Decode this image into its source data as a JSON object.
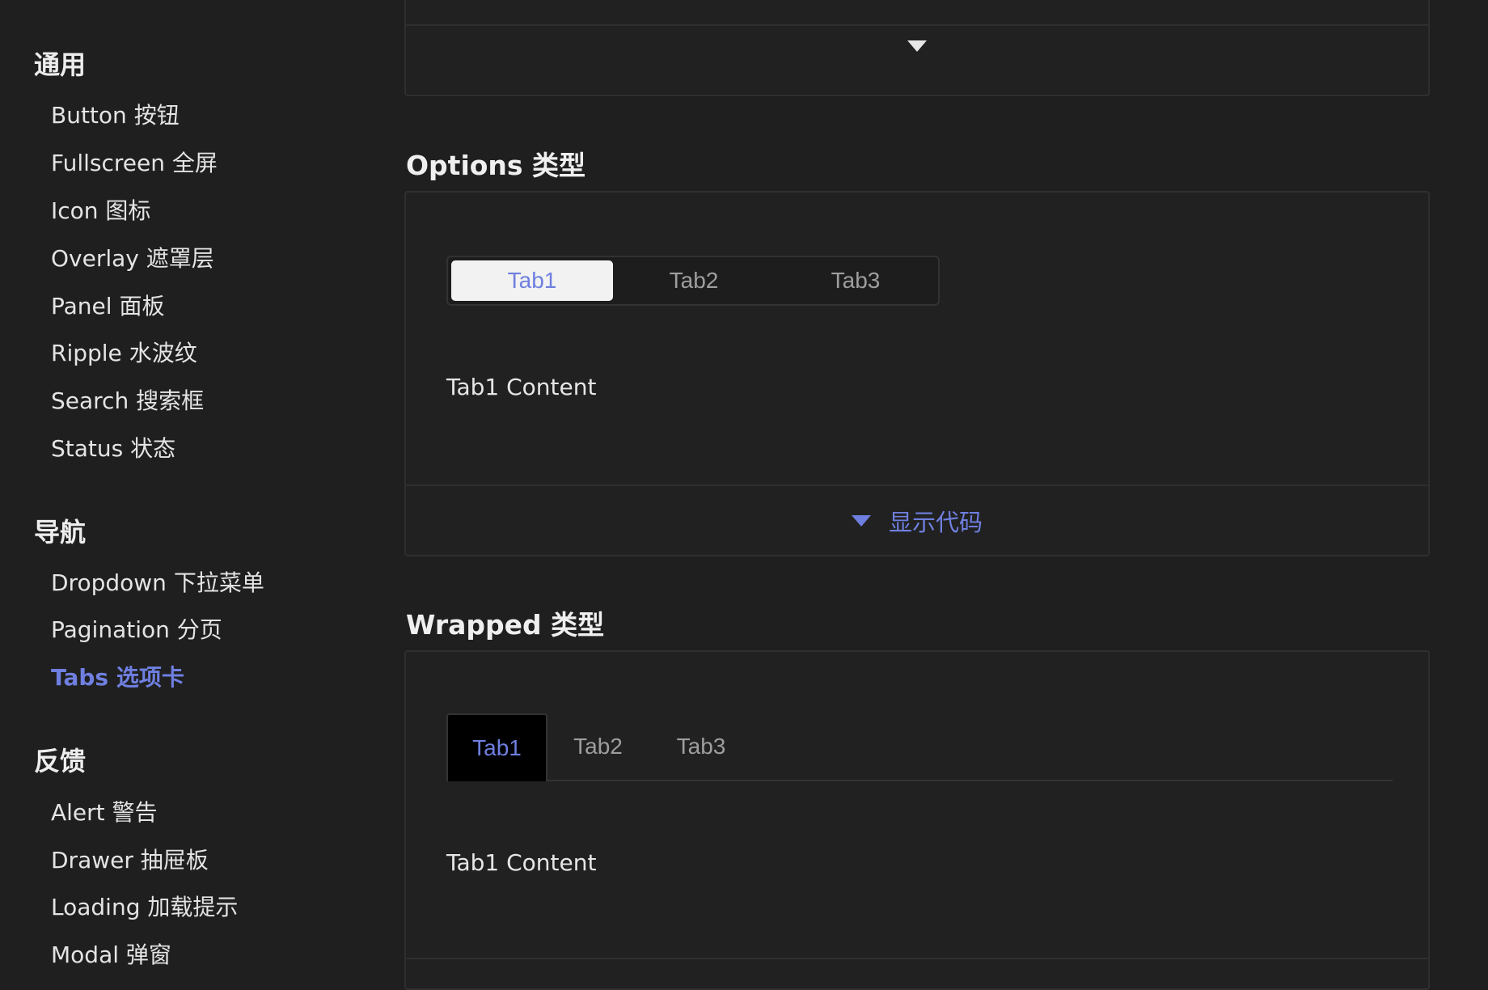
{
  "sidebar": {
    "groups": [
      {
        "title": "通用",
        "items": [
          "Button 按钮",
          "Fullscreen 全屏",
          "Icon 图标",
          "Overlay 遮罩层",
          "Panel 面板",
          "Ripple 水波纹",
          "Search 搜索框",
          "Status 状态"
        ]
      },
      {
        "title": "导航",
        "items": [
          "Dropdown 下拉菜单",
          "Pagination 分页",
          "Tabs 选项卡"
        ]
      },
      {
        "title": "反馈",
        "items": [
          "Alert 警告",
          "Drawer 抽屉板",
          "Loading 加载提示",
          "Modal 弹窗"
        ]
      }
    ],
    "active_item": "Tabs 选项卡"
  },
  "options_section": {
    "title": "Options 类型",
    "tabs": [
      "Tab1",
      "Tab2",
      "Tab3"
    ],
    "active_tab": "Tab1",
    "content": "Tab1 Content",
    "show_code_label": "显示代码"
  },
  "wrapped_section": {
    "title": "Wrapped 类型",
    "tabs": [
      "Tab1",
      "Tab2",
      "Tab3"
    ],
    "active_tab": "Tab1",
    "content": "Tab1 Content"
  },
  "colors": {
    "background": "#1f1f1f",
    "accent": "#6f7fe0",
    "border": "#2f2f2f"
  }
}
